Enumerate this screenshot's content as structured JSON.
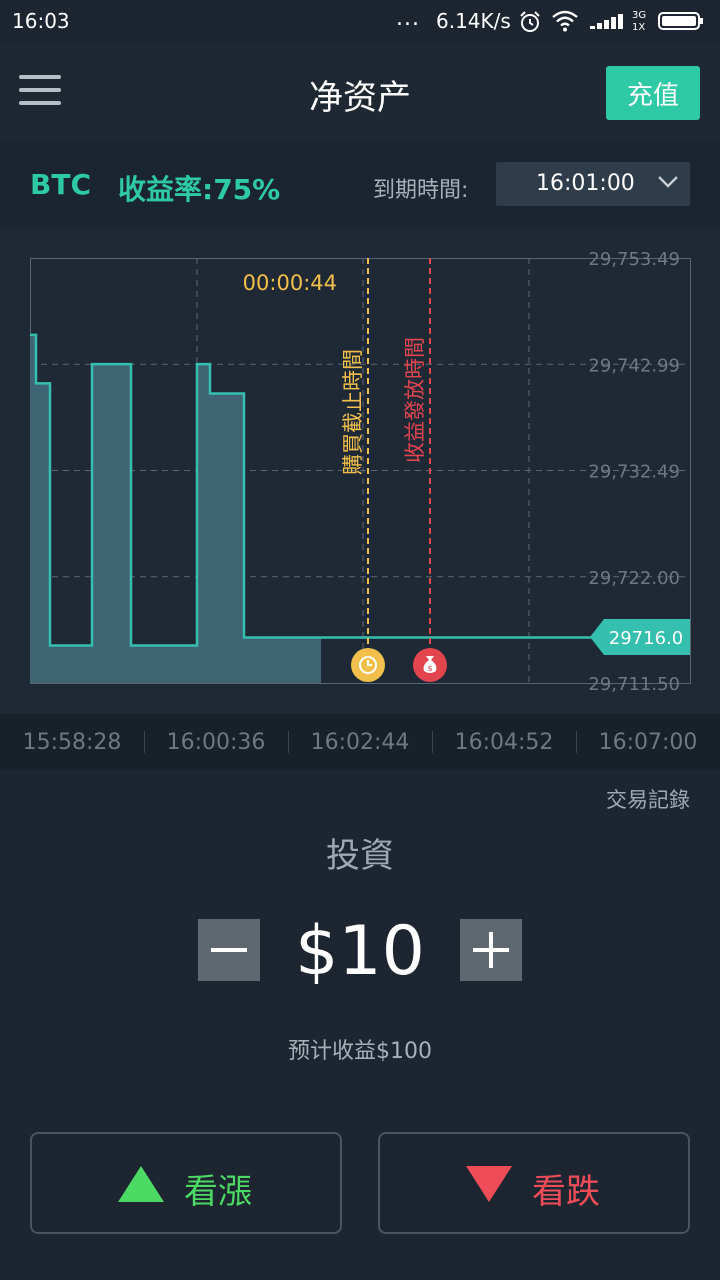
{
  "status_bar": {
    "time": "16:03",
    "dots": "...",
    "network_speed": "6.14K/s",
    "sim_label_top": "3G",
    "sim_label_bottom": "1X"
  },
  "header": {
    "title": "净资产",
    "recharge_label": "充值"
  },
  "info_bar": {
    "asset": "BTC",
    "payout_rate": "收益率:75%",
    "expiry_label": "到期時間:",
    "expiry_value": "16:01:00"
  },
  "chart": {
    "countdown": "00:00:44",
    "purchase_deadline_label": "購買截止時間",
    "payout_time_label": "收益發放時間",
    "current_price_label": "29716.0",
    "price_ticks": [
      "29,753.49",
      "29,742.99",
      "29,732.49",
      "29,722.00",
      "29,711.50"
    ],
    "time_ticks": [
      "15:58:28",
      "16:00:36",
      "16:02:44",
      "16:04:52",
      "16:07:00"
    ]
  },
  "chart_data": {
    "type": "area",
    "y_range": [
      29711.5,
      29753.49
    ],
    "series_steps": [
      {
        "value": 29745.9
      },
      {
        "value": 29741.1
      },
      {
        "value": 29715.2
      },
      {
        "value": 29743.0
      },
      {
        "value": 29715.2
      },
      {
        "value": 29743.0
      },
      {
        "value": 29740.1
      },
      {
        "value": 29716.0
      }
    ],
    "current_price": 29716.0,
    "colors": {
      "line": "#35bfae",
      "fill": "#3f6474",
      "purchase_deadline": "#f2c04a",
      "payout_time": "#e2454e"
    }
  },
  "trade": {
    "history_link": "交易記錄",
    "invest_label": "投資",
    "amount": "$10",
    "expected_profit": "预计收益$100",
    "rise_label": "看漲",
    "fall_label": "看跌"
  },
  "colors": {
    "accent": "#2ec9a5",
    "rise": "#4cd964",
    "fall": "#ee4d58",
    "background": "#1c2530"
  },
  "icons": {
    "menu": "hamburger-menu-icon",
    "alarm": "alarm-clock-icon",
    "wifi": "wifi-icon",
    "signal": "signal-icon",
    "battery": "battery-icon",
    "clock": "clock-icon",
    "money_bag": "money-bag-icon",
    "minus": "minus-icon",
    "plus": "plus-icon",
    "triangle_up": "triangle-up-icon",
    "triangle_down": "triangle-down-icon"
  }
}
